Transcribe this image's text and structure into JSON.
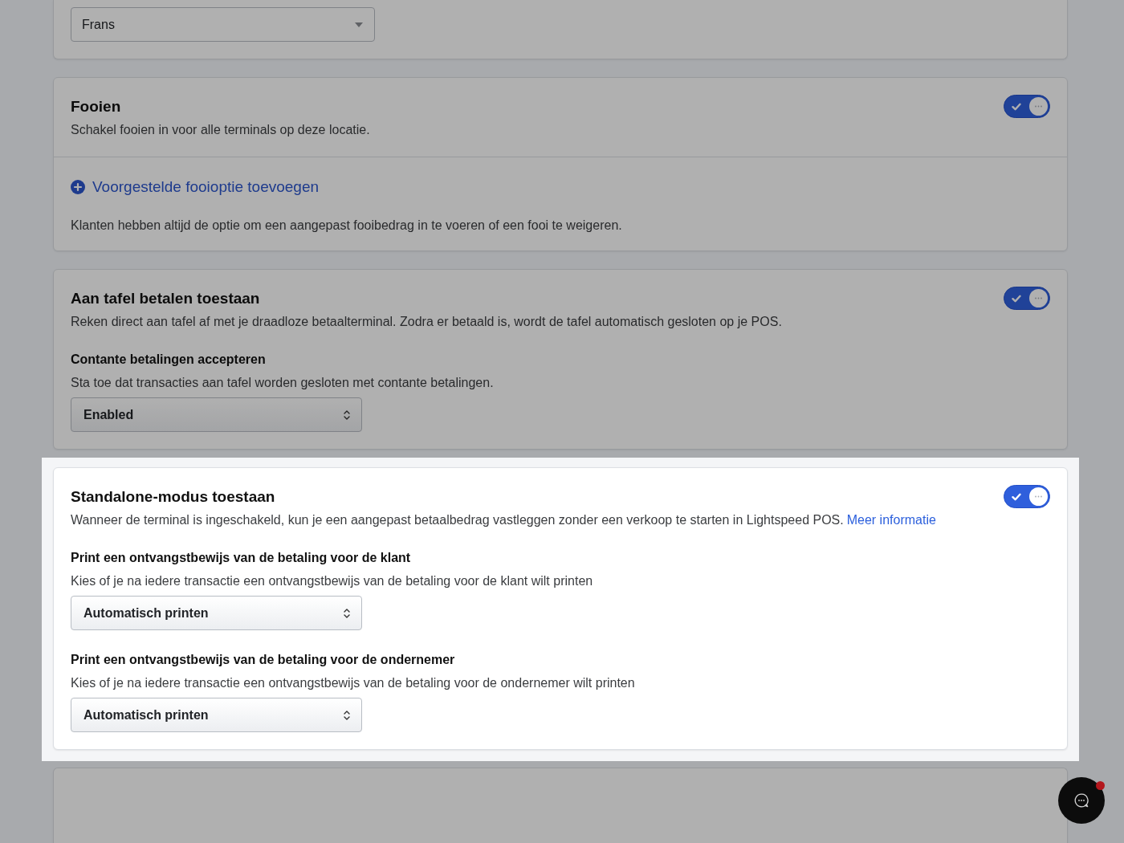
{
  "cards": [
    {
      "highlighted": false,
      "blocks": [
        {
          "kind": "dropdown",
          "value": "Frans"
        }
      ]
    },
    {
      "highlighted": false,
      "title": "Fooien",
      "description": "Schakel fooien in voor alle terminals op deze locatie.",
      "toggle": {
        "on": true
      },
      "footer": {
        "link": "Voorgestelde fooioptie toevoegen",
        "note": "Klanten hebben altijd de optie om een aangepast fooibedrag in te voeren of een fooi te weigeren."
      }
    },
    {
      "highlighted": false,
      "title": "Aan tafel betalen toestaan",
      "description": "Reken direct aan tafel af met je draadloze betaalterminal. Zodra er betaald is, wordt de tafel automatisch gesloten op je POS.",
      "toggle": {
        "on": true
      },
      "blocks": [
        {
          "kind": "setting",
          "title": "Contante betalingen accepteren",
          "description": "Sta toe dat transacties aan tafel worden gesloten met contante betalingen.",
          "select": {
            "value": "Enabled"
          }
        }
      ]
    },
    {
      "highlighted": true,
      "title": "Standalone-modus toestaan",
      "description": "Wanneer de terminal is ingeschakeld, kun je een aangepast betaalbedrag vastleggen zonder een verkoop te starten in Lightspeed POS.",
      "link": "Meer informatie",
      "toggle": {
        "on": true
      },
      "blocks": [
        {
          "kind": "setting",
          "title": "Print een ontvangstbewijs van de betaling voor de klant",
          "description": "Kies of je na iedere transactie een ontvangstbewijs van de betaling voor de klant wilt printen",
          "select": {
            "value": "Automatisch printen"
          }
        },
        {
          "kind": "setting",
          "title": "Print een ontvangstbewijs van de betaling voor de ondernemer",
          "description": "Kies of je na iedere transactie een ontvangstbewijs van de betaling voor de ondernemer wilt printen",
          "select": {
            "value": "Automatisch printen"
          }
        }
      ]
    }
  ],
  "chat_button": {
    "unread": true
  }
}
